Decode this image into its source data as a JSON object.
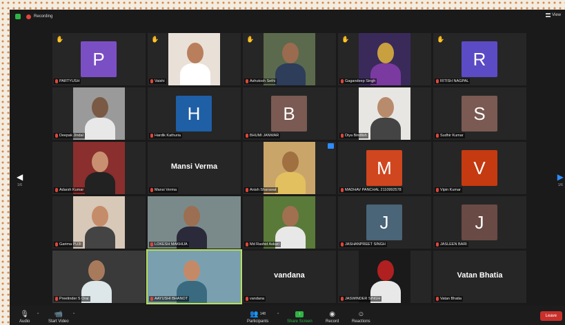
{
  "topbar": {
    "recording_label": "Recording",
    "view_label": "View"
  },
  "pager": {
    "left_page": "1/6",
    "right_page": "1/6"
  },
  "colors": {
    "raised_hand": "#f3c623",
    "muted": "#e0463b",
    "share_green": "#2fb344",
    "leave_red": "#c9302c",
    "active_speaker": "#b9e05a"
  },
  "tiles": [
    {
      "name": "PARTYUSH",
      "initial": "P",
      "bg": "#7b4fc4",
      "hand": true
    },
    {
      "name": "Vaishi",
      "photo": true,
      "hand": true
    },
    {
      "name": "Ashutosh Sethi",
      "photo": true,
      "hand": true
    },
    {
      "name": "Gagandeep Singh",
      "photo": true,
      "hand": true
    },
    {
      "name": "RITISH NAGPAL",
      "initial": "R",
      "bg": "#5b4bc4",
      "hand": true
    },
    {
      "name": "Deepak Jindal",
      "photo": true
    },
    {
      "name": "Hardik Kathuria",
      "initial": "H",
      "bg": "#1f5fa6"
    },
    {
      "name": "BHUMI JANWAR",
      "initial": "B",
      "bg": "#7a5a52"
    },
    {
      "name": "Diya Bindlish",
      "photo": true
    },
    {
      "name": "Sudhir Kumar",
      "initial": "S",
      "bg": "#7a5a52"
    },
    {
      "name": "Adarsh Kumar",
      "photo": true
    },
    {
      "name": "Mansi Verma",
      "bigname": "Mansi Verma"
    },
    {
      "name": "Anish Sharawat",
      "photo": true,
      "pin": true
    },
    {
      "name": "MADHAV PANCHAL 2110992578",
      "initial": "M",
      "bg": "#d0461f"
    },
    {
      "name": "Vipin Kumar",
      "initial": "V",
      "bg": "#c53a10"
    },
    {
      "name": "Garima PU3I",
      "photo": true
    },
    {
      "name": "LOKESH MAKHIJA",
      "photo": true
    },
    {
      "name": "Md Rashid Askari",
      "photo": true
    },
    {
      "name": "JASHANPREET SINGH",
      "initial": "J",
      "bg": "#4a6478"
    },
    {
      "name": "JASLEEN BARI",
      "initial": "J",
      "bg": "#6a4a44"
    },
    {
      "name": "Preetinder S Orai",
      "photo": true
    },
    {
      "name": "AAYUSHI BHANOT",
      "photo": true,
      "active": true
    },
    {
      "name": "vandana",
      "bigname": "vandana"
    },
    {
      "name": "JASWINDER SINGH",
      "photo": true
    },
    {
      "name": "Vatan Bhatia",
      "bigname": "Vatan Bhatia"
    }
  ],
  "toolbar": {
    "audio": "Audio",
    "start_video": "Start Video",
    "participants": "Participants",
    "participants_count": "148",
    "share_screen": "Share Screen",
    "record": "Record",
    "reactions": "Reactions",
    "leave": "Leave"
  }
}
